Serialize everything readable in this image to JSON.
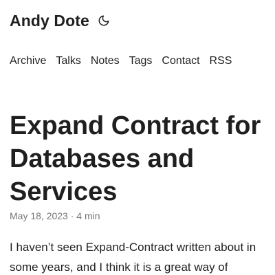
{
  "site": {
    "title": "Andy Dote",
    "theme_toggle_icon": "moon-icon"
  },
  "nav": {
    "items": [
      {
        "label": "Archive"
      },
      {
        "label": "Talks"
      },
      {
        "label": "Notes"
      },
      {
        "label": "Tags"
      },
      {
        "label": "Contact"
      },
      {
        "label": "RSS"
      }
    ]
  },
  "post": {
    "title": "Expand Contract for Databases and Services",
    "date": "May 18, 2023",
    "separator": "·",
    "reading_time": "4 min",
    "intro": "I haven’t seen Expand-Contract written about in some years, and I think it is a great way of"
  }
}
